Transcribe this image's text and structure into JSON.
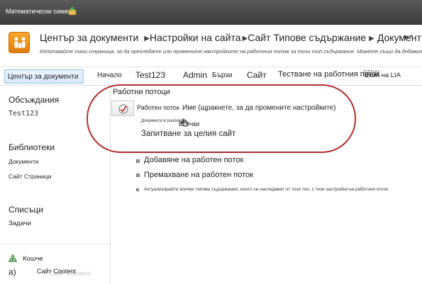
{
  "window": {
    "title": "Математически символ"
  },
  "breadcrumb": {
    "items": [
      "Център за документи",
      "Настройки на сайта",
      "Сайт Типове съдържание",
      "Документ"
    ],
    "description": "Използвайте тази страница, за да прегледате или промените настройките на работния поток за този тип съдържание. Можете също да добавите"
  },
  "topnav": {
    "items": [
      "Център за документи",
      "Начало",
      "Test123",
      "Admin",
      "Бързи",
      "Сайт",
      "Тестване на работния поток",
      "SBW",
      "Екип на LIA"
    ]
  },
  "leftnav": {
    "discussions_heading": "Обсъждания",
    "discussions_items": [
      "Test123"
    ],
    "libraries_heading": "Библиотеки",
    "libraries_items": [
      "Документи",
      "Сайт Страници"
    ],
    "lists_heading": "Списъци",
    "lists_items": [
      "Задачи"
    ],
    "recycle_bin": "Кошче",
    "site_actions": "а)",
    "site_content": "Сайт Content",
    "site_content_ghost": "Сайт Content"
  },
  "main": {
    "section_title": "Работни потоци",
    "workflow_label": "Работен поток",
    "workflow_name_header": "Име (щракнете, за да промените настройките)",
    "doc_small": "Документи в разлика",
    "all_label": "Всички",
    "sitewide_label": "Запитване за целия сайт",
    "actions": [
      "Добавяне на работен поток",
      "Премахване на работен поток"
    ],
    "update_note": "Актуализирайте всички типове съдържание, които се наследяват от този тип, с тези настройки на работния поток"
  },
  "colors": {
    "highlight": "#b03030",
    "logo": "#f39a1f",
    "topbar": "#4a4a4a",
    "nav_selected": "#d6e8f8"
  }
}
